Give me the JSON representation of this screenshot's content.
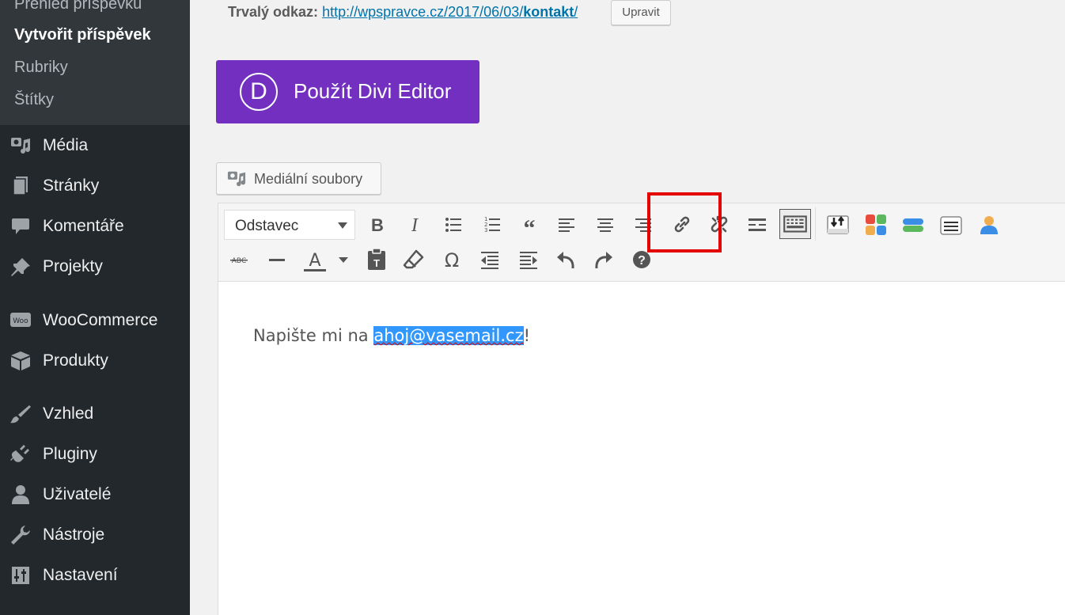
{
  "sidebar": {
    "submenu": [
      {
        "label": "Přehled příspěvků"
      },
      {
        "label": "Vytvořit příspěvek"
      },
      {
        "label": "Rubriky"
      },
      {
        "label": "Štítky"
      }
    ],
    "menu": [
      {
        "label": "Média",
        "icon": "media-icon"
      },
      {
        "label": "Stránky",
        "icon": "pages-icon"
      },
      {
        "label": "Komentáře",
        "icon": "comments-icon"
      },
      {
        "label": "Projekty",
        "icon": "pin-icon"
      },
      {
        "label": "WooCommerce",
        "icon": "woo-icon"
      },
      {
        "label": "Produkty",
        "icon": "box-icon"
      },
      {
        "label": "Vzhled",
        "icon": "brush-icon"
      },
      {
        "label": "Pluginy",
        "icon": "plug-icon"
      },
      {
        "label": "Uživatelé",
        "icon": "user-icon"
      },
      {
        "label": "Nástroje",
        "icon": "wrench-icon"
      },
      {
        "label": "Nastavení",
        "icon": "settings-icon"
      }
    ]
  },
  "permalink": {
    "label": "Trvalý odkaz:",
    "url_base": "http://wpspravce.cz/2017/06/03/",
    "url_slug": "kontakt",
    "url_end": "/",
    "edit_label": "Upravit"
  },
  "divi": {
    "logo": "D",
    "label": "Použít Divi Editor"
  },
  "media_button": {
    "label": "Mediální soubory"
  },
  "format_select": {
    "value": "Odstavec"
  },
  "toolbar": {
    "row1": [
      "bold-icon",
      "italic-icon",
      "bullet-list-icon",
      "numbered-list-icon",
      "blockquote-icon",
      "align-left-icon",
      "align-center-icon",
      "align-right-icon",
      "link-icon",
      "unlink-icon",
      "read-more-icon",
      "toolbar-toggle-icon",
      "download-icon",
      "blocks-icon",
      "buttons-icon",
      "list-box-icon",
      "user-box-icon"
    ],
    "row2": [
      "strikethrough-icon",
      "horizontal-line-icon",
      "text-color-icon",
      "paste-text-icon",
      "clear-formatting-icon",
      "special-char-icon",
      "outdent-icon",
      "indent-icon",
      "undo-icon",
      "redo-icon",
      "help-icon"
    ]
  },
  "editor": {
    "text_before": "Napište mi na ",
    "email": "ahoj@vasemail.cz",
    "text_after": "!"
  },
  "colors": {
    "sidebar": "#23282d",
    "submenu": "#32373c",
    "divi": "#7330c0",
    "highlight": "#e50000",
    "selection": "#3297fd",
    "link": "#0073aa"
  }
}
